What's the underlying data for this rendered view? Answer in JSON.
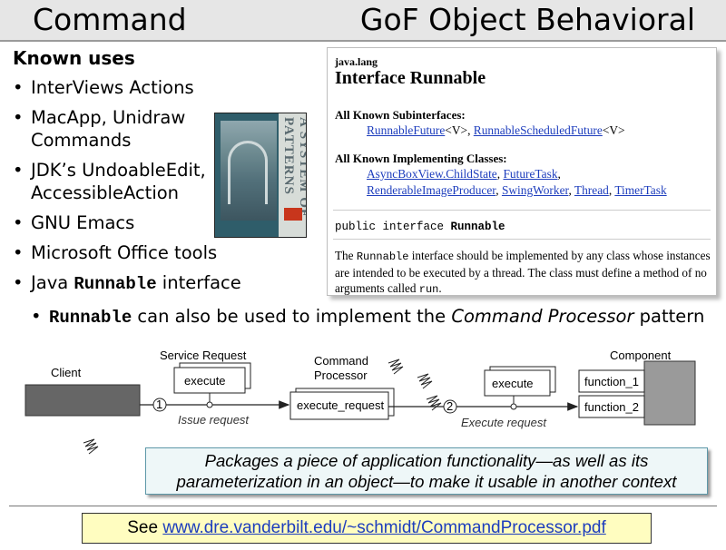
{
  "title": {
    "left": "Command",
    "right": "GoF Object Behavioral"
  },
  "known_uses": {
    "heading": "Known uses",
    "items": [
      "InterViews Actions",
      "MacApp, Unidraw",
      "Commands",
      "JDK’s UndoableEdit,",
      "AccessibleAction",
      "GNU Emacs",
      "Microsoft Office tools"
    ],
    "java_item": {
      "pre": "Java ",
      "code": "Runnable",
      "post": " interface"
    },
    "sub_item": {
      "code": "Runnable",
      "mid": " can also be used to implement the ",
      "em": "Command Processor",
      "post": " pattern"
    }
  },
  "book": {
    "spine": "A SYSTEM OF PATTERNS"
  },
  "javadoc": {
    "package": "java.lang",
    "interface_title": "Interface Runnable",
    "subinterfaces_label": "All Known Subinterfaces:",
    "subinterfaces": [
      "RunnableFuture",
      "RunnableScheduledFuture"
    ],
    "generic": "<V>",
    "implementing_label": "All Known Implementing Classes:",
    "implementing": [
      "AsyncBoxView.ChildState",
      "FutureTask",
      "RenderableImageProducer",
      "SwingWorker",
      "Thread",
      "TimerTask"
    ],
    "declaration": {
      "pre": "public interface ",
      "name": "Runnable"
    },
    "description": {
      "p1": "The ",
      "code1": "Runnable",
      "p2": " interface should be implemented by any class whose instances are intended to be executed by a thread. The class must define a method of no arguments called ",
      "code2": "run",
      "p3": "."
    }
  },
  "diagram": {
    "client": "Client",
    "service_request": "Service Request",
    "execute": "execute",
    "command_processor_1": "Command",
    "command_processor_2": "Processor",
    "execute_request": "execute_request",
    "issue_request": "Issue request",
    "execute2": "execute",
    "execute_request_label": "Execute request",
    "component": "Component",
    "function_1": "function_1",
    "function_2": "function_2",
    "step1": "1",
    "step2": "2"
  },
  "callout": {
    "line1": "Packages a piece of application functionality—as well as its",
    "line2": "parameterization in an object—to make it usable in another context"
  },
  "footer": {
    "prefix": "See ",
    "url": "www.dre.vanderbilt.edu/~schmidt/CommandProcessor.pdf"
  }
}
